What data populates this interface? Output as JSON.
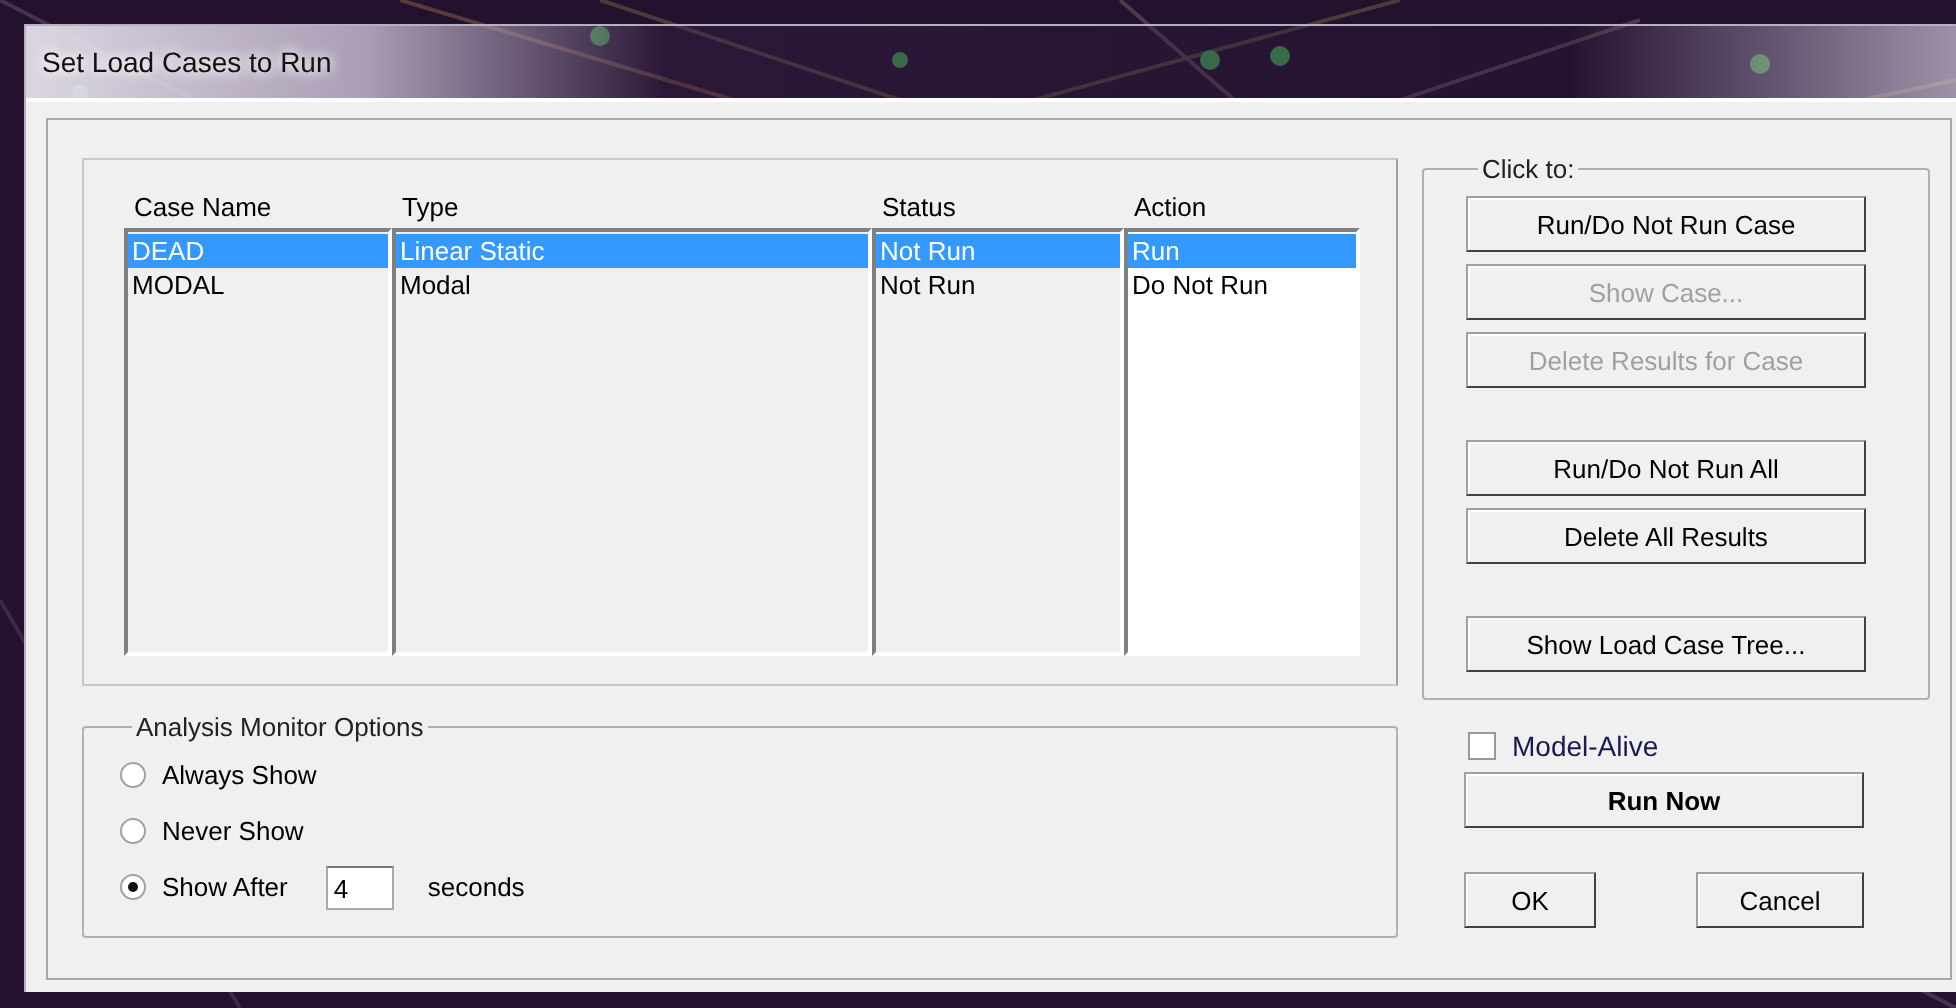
{
  "window": {
    "title": "Set Load Cases to Run"
  },
  "cases_list": {
    "columns": [
      {
        "label": "Case Name"
      },
      {
        "label": "Type"
      },
      {
        "label": "Status"
      },
      {
        "label": "Action"
      }
    ],
    "rows": [
      {
        "case_name": "DEAD",
        "type": "Linear Static",
        "status": "Not Run",
        "action": "Run",
        "selected": true
      },
      {
        "case_name": "MODAL",
        "type": "Modal",
        "status": "Not Run",
        "action": "Do Not Run",
        "selected": false
      }
    ]
  },
  "click_to": {
    "title": "Click to:",
    "button_groups": [
      [
        {
          "label": "Run/Do Not Run Case",
          "disabled": false
        },
        {
          "label": "Show Case...",
          "disabled": true
        },
        {
          "label": "Delete Results for Case",
          "disabled": true
        }
      ],
      [
        {
          "label": "Run/Do Not Run All",
          "disabled": false
        },
        {
          "label": "Delete All Results",
          "disabled": false
        }
      ],
      [
        {
          "label": "Show Load Case Tree...",
          "disabled": false
        }
      ]
    ]
  },
  "monitor_options": {
    "title": "Analysis Monitor Options",
    "options": [
      {
        "label": "Always Show",
        "selected": false
      },
      {
        "label": "Never Show",
        "selected": false
      },
      {
        "label": "Show After",
        "selected": true,
        "value": "4",
        "unit": "seconds"
      }
    ]
  },
  "model_alive": {
    "label": "Model-Alive",
    "checked": false
  },
  "run_button": {
    "label": "Run Now"
  },
  "dialog_buttons": [
    "OK",
    "Cancel"
  ]
}
